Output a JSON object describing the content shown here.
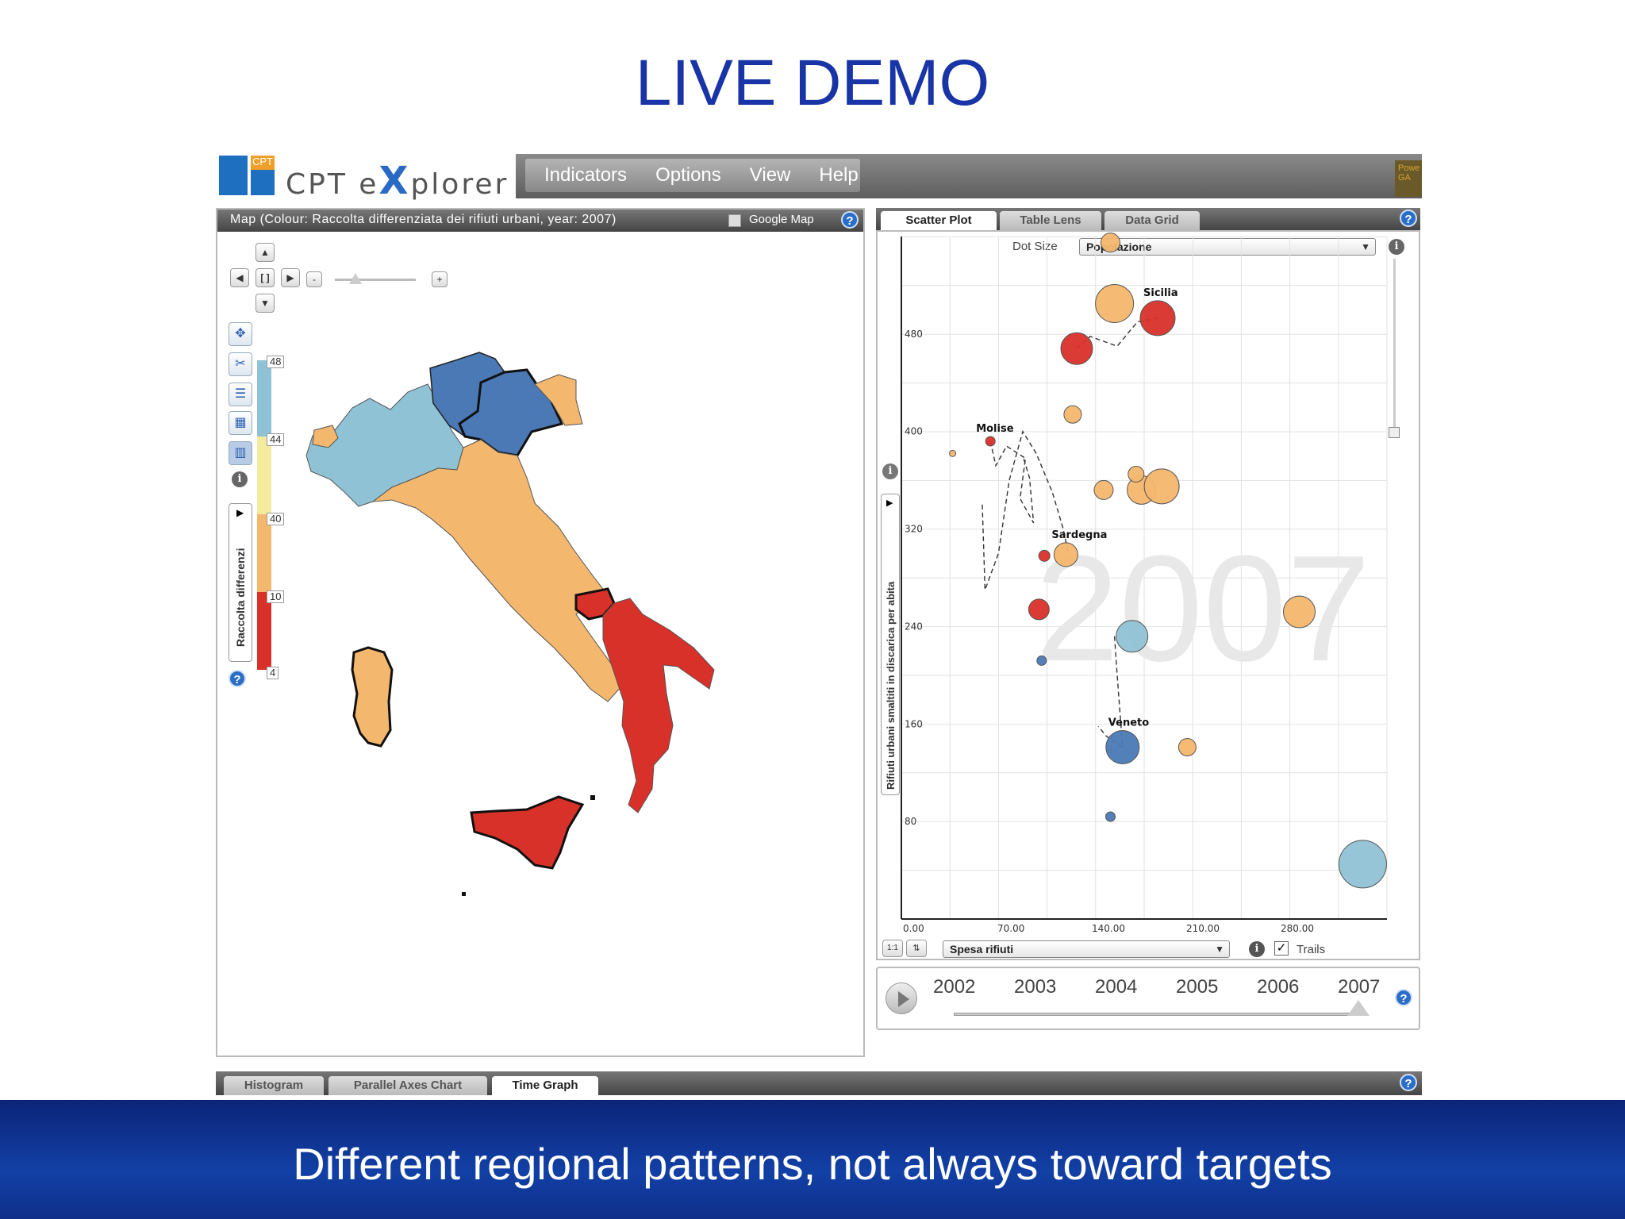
{
  "slide": {
    "title": "LIVE DEMO",
    "footer": "Different regional patterns, not always toward targets"
  },
  "app": {
    "logo_text_pre": "CPT e",
    "logo_text_x": "X",
    "logo_text_post": "plorer",
    "logo_badge": "CPT",
    "menu": [
      "Indicators",
      "Options",
      "View",
      "Help"
    ],
    "powered_text": "Powe GA"
  },
  "map": {
    "header": "Map (Colour: Raccolta differenziata dei rifiuti urbani, year: 2007)",
    "google_map_label": "Google Map",
    "legend_title": "Raccolta differenzi",
    "legend_labels": [
      "48",
      "44",
      "40",
      "10",
      "4"
    ],
    "colors": {
      "blue": "#4a79b5",
      "lightblue": "#8fc2d4",
      "orange": "#f4b76e",
      "red": "#d8312a",
      "pale": "#f4eba0"
    }
  },
  "scatter": {
    "tabs": [
      "Scatter Plot",
      "Table Lens",
      "Data Grid"
    ],
    "dot_size_label": "Dot Size",
    "dot_size_value": "Popolazione",
    "x_select_value": "Spesa rifiuti",
    "trails_label": "Trails",
    "ratio_btn": "1:1",
    "year_watermark": "2007",
    "y_axis_title": "Rifiuti urbani smaltiti in discarica per abita"
  },
  "chart_data": {
    "type": "scatter",
    "x_ticks": [
      "0.00",
      "70.00",
      "140.00",
      "210.00",
      "280.00"
    ],
    "y_ticks": [
      "480",
      "400",
      "320",
      "240",
      "160",
      "80"
    ],
    "xlim": [
      0,
      360
    ],
    "ylim": [
      0,
      560
    ],
    "points": [
      {
        "label": "",
        "x": 155,
        "y": 555,
        "r": 12,
        "color": "#f4b76e"
      },
      {
        "label": "",
        "x": 158,
        "y": 505,
        "r": 24,
        "color": "#f4b76e"
      },
      {
        "label": "Sicilia",
        "x": 190,
        "y": 493,
        "r": 22,
        "color": "#d8312a"
      },
      {
        "label": "",
        "x": 130,
        "y": 468,
        "r": 20,
        "color": "#d8312a"
      },
      {
        "label": "",
        "x": 127,
        "y": 414,
        "r": 11,
        "color": "#f4b76e"
      },
      {
        "label": "Molise",
        "x": 66,
        "y": 392,
        "r": 6,
        "color": "#d8312a"
      },
      {
        "label": "",
        "x": 38,
        "y": 382,
        "r": 4,
        "color": "#f4b76e"
      },
      {
        "label": "",
        "x": 150,
        "y": 352,
        "r": 12,
        "color": "#f4b76e"
      },
      {
        "label": "",
        "x": 178,
        "y": 352,
        "r": 18,
        "color": "#f4b76e"
      },
      {
        "label": "",
        "x": 193,
        "y": 355,
        "r": 22,
        "color": "#f4b76e"
      },
      {
        "label": "",
        "x": 174,
        "y": 365,
        "r": 10,
        "color": "#f4b76e"
      },
      {
        "label": "Sardegna",
        "x": 122,
        "y": 299,
        "r": 15,
        "color": "#f4b76e"
      },
      {
        "label": "",
        "x": 106,
        "y": 298,
        "r": 7,
        "color": "#d8312a"
      },
      {
        "label": "",
        "x": 102,
        "y": 254,
        "r": 13,
        "color": "#d8312a"
      },
      {
        "label": "",
        "x": 171,
        "y": 232,
        "r": 20,
        "color": "#8fc2d4"
      },
      {
        "label": "",
        "x": 295,
        "y": 252,
        "r": 20,
        "color": "#f4b76e"
      },
      {
        "label": "",
        "x": 104,
        "y": 212,
        "r": 6,
        "color": "#4a79b5"
      },
      {
        "label": "Veneto",
        "x": 164,
        "y": 141,
        "r": 21,
        "color": "#4a79b5"
      },
      {
        "label": "",
        "x": 212,
        "y": 141,
        "r": 11,
        "color": "#f4b76e"
      },
      {
        "label": "",
        "x": 155,
        "y": 84,
        "r": 6,
        "color": "#4a79b5"
      },
      {
        "label": "",
        "x": 342,
        "y": 45,
        "r": 30,
        "color": "#8fc2d4"
      }
    ]
  },
  "timeline": {
    "years": [
      "2002",
      "2003",
      "2004",
      "2005",
      "2006",
      "2007"
    ],
    "selected_year": "2007"
  },
  "bottom_tabs": [
    "Histogram",
    "Parallel Axes Chart",
    "Time Graph"
  ]
}
